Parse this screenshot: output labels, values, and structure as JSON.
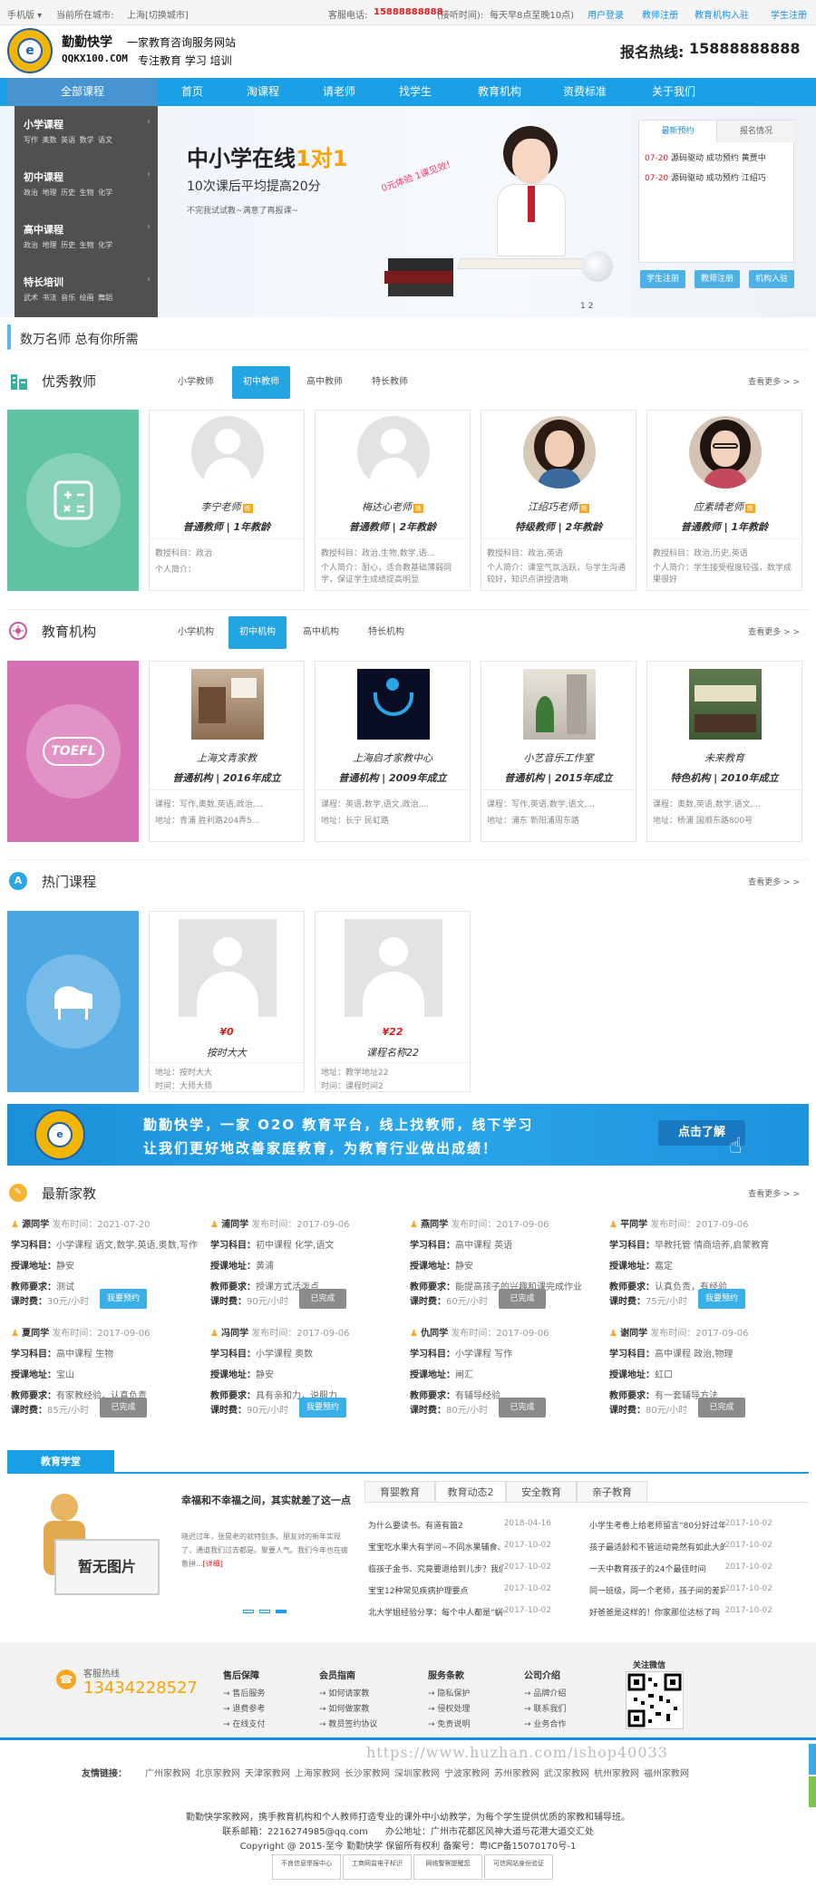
{
  "topbar": {
    "mobile": "手机版",
    "city_label": "当前所在城市:",
    "city": "上海",
    "switch_city": "[切换城市]",
    "phone_label": "客服电话:",
    "phone": "15888888888",
    "hours_label": "(接听时间):",
    "hours": "每天早8点至晚10点)",
    "login": "用户登录",
    "teacher_reg": "教师注册",
    "org_reg": "教育机构入驻",
    "student_reg": "学生注册"
  },
  "header": {
    "brand": "勤勤快学",
    "tagline": "一家教育咨询服务网站",
    "domain": "QQKX100.COM",
    "slogan": "专注教育 学习 培训",
    "hotline_label": "报名热线:",
    "hotline": "15888888888"
  },
  "nav": {
    "all": "全部课程",
    "items": [
      "首页",
      "淘课程",
      "请老师",
      "找学生",
      "教育机构",
      "资费标准",
      "关于我们"
    ]
  },
  "categories": [
    {
      "title": "小学课程",
      "subs": "写作 奥数 英语 数学 语文"
    },
    {
      "title": "初中课程",
      "subs": "政治 地理 历史 生物 化学"
    },
    {
      "title": "高中课程",
      "subs": "政治 地理 历史 生物 化学"
    },
    {
      "title": "特长培训",
      "subs": "武术 书法 音乐 绘画 舞蹈"
    }
  ],
  "banner": {
    "headline_a": "中小学在线",
    "headline_b": "1对1",
    "sub": "10次课后平均提高20分",
    "small": "不完我试试教~满意了再报课~",
    "stamp": "0元体验 1课见效！",
    "page_dots": "1  2"
  },
  "booking_panel": {
    "tab_latest": "最新预约",
    "tab_report": "报名情况",
    "rows": [
      {
        "date": "07-20",
        "text": "源码驱动 成功预约 黄贾中"
      },
      {
        "date": "07-20",
        "text": "源码驱动 成功预约 江绍巧"
      }
    ],
    "btn_student": "学生注册",
    "btn_teacher": "教师注册",
    "btn_org": "机构入驻"
  },
  "section_banner": "数万名师 总有你所需",
  "teachers": {
    "title": "优秀教师",
    "tabs": [
      "小学教师",
      "初中教师",
      "高中教师",
      "特长教师"
    ],
    "active_tab": 1,
    "more": "查看更多 > >",
    "badge": "练",
    "items": [
      {
        "name": "李宁老师",
        "level": "普通教师 | 1年教龄",
        "subject": "教授科目：政治",
        "intro": "个人简介："
      },
      {
        "name": "梅达心老师",
        "level": "普通教师 | 2年教龄",
        "subject": "教授科目：政治,生物,数学,语...",
        "intro": "个人简介：耐心，适合教基础薄弱同学，保证学生成绩提高明显"
      },
      {
        "name": "江绍巧老师",
        "level": "特级教师 | 2年教龄",
        "subject": "教授科目：政治,英语",
        "intro": "个人简介：课堂气氛活跃，与学生沟通较好，知识点讲授清晰"
      },
      {
        "name": "应素晴老师",
        "level": "普通教师 | 1年教龄",
        "subject": "教授科目：政治,历史,英语",
        "intro": "个人简介：学生接受程度较强，数学成果很好"
      }
    ]
  },
  "orgs": {
    "title": "教育机构",
    "tabs": [
      "小学机构",
      "初中机构",
      "高中机构",
      "特长机构"
    ],
    "active_tab": 1,
    "more": "查看更多 > >",
    "tile_text": "TOEFL",
    "items": [
      {
        "name": "上海文青家教",
        "level": "普通机构 | 2016年成立",
        "course": "课程：写作,奥数,英语,政治,...",
        "addr": "地址：青浦 胜利路204弄5..."
      },
      {
        "name": "上海启才家教中心",
        "level": "普通机构 | 2009年成立",
        "course": "课程：英语,数学,语文,政治,...",
        "addr": "地址：长宁 民虹路"
      },
      {
        "name": "小艺音乐工作室",
        "level": "普通机构 | 2015年成立",
        "course": "课程：写作,英语,数学,语文,...",
        "addr": "地址：浦东 新阳浦周东路"
      },
      {
        "name": "未来教育",
        "level": "特色机构 | 2010年成立",
        "course": "课程：奥数,英语,数学,语文,...",
        "addr": "地址：杨浦 国顺东路800号"
      }
    ]
  },
  "courses": {
    "title": "热门课程",
    "more": "查看更多 > >",
    "items": [
      {
        "price": "¥0",
        "name": "按时大大",
        "addr": "地址：按时大大",
        "time": "时间：大师大师"
      },
      {
        "price": "¥22",
        "name": "课程名称22",
        "addr": "地址：教学地址22",
        "time": "时间：课程时间2"
      }
    ]
  },
  "ad": {
    "line1": "勤勤快学，一家 O2O 教育平台，线上找教师，线下学习",
    "line2": "让我们更好地改善家庭教育，为教育行业做出成绩！",
    "button": "点击了解"
  },
  "jobs": {
    "title": "最新家教",
    "more": "查看更多 > >",
    "labels": {
      "posted": "发布时间：",
      "subject": "学习科目：",
      "area": "授课地址：",
      "require": "教师要求：",
      "fee": "课时费："
    },
    "items": [
      {
        "name": "源同学",
        "date": "2021-07-20",
        "subject": "小学课程 语文,数学,英语,奥数,写作",
        "area": "静安",
        "require": "测试",
        "fee": "30元/小时",
        "btn": "我要预约",
        "state": "blue"
      },
      {
        "name": "浦同学",
        "date": "2017-09-06",
        "subject": "初中课程 化学,语文",
        "area": "黄浦",
        "require": "授课方式活泼点",
        "fee": "90元/小时",
        "btn": "已完成",
        "state": "gray"
      },
      {
        "name": "燕同学",
        "date": "2017-09-06",
        "subject": "高中课程 英语",
        "area": "静安",
        "require": "能提高孩子的兴趣和课完成作业",
        "fee": "60元/小时",
        "btn": "已完成",
        "state": "gray"
      },
      {
        "name": "平同学",
        "date": "2017-09-06",
        "subject": "早教托管 情商培养,启蒙教育",
        "area": "嘉定",
        "require": "认真负责，有经验",
        "fee": "75元/小时",
        "btn": "我要预约",
        "state": "blue"
      },
      {
        "name": "夏同学",
        "date": "2017-09-06",
        "subject": "高中课程 生物",
        "area": "宝山",
        "require": "有家教经验，认真负责",
        "fee": "85元/小时",
        "btn": "已完成",
        "state": "gray"
      },
      {
        "name": "冯同学",
        "date": "2017-09-06",
        "subject": "小学课程 奥数",
        "area": "静安",
        "require": "具有亲和力，说服力",
        "fee": "90元/小时",
        "btn": "我要预约",
        "state": "blue"
      },
      {
        "name": "仇同学",
        "date": "2017-09-06",
        "subject": "小学课程 写作",
        "area": "闸汇",
        "require": "有辅导经验",
        "fee": "80元/小时",
        "btn": "已完成",
        "state": "gray"
      },
      {
        "name": "谢同学",
        "date": "2017-09-06",
        "subject": "高中课程 政治,物理",
        "area": "虹口",
        "require": "有一套辅导方法",
        "fee": "80元/小时",
        "btn": "已完成",
        "state": "gray"
      }
    ]
  },
  "edu": {
    "title": "教育学堂",
    "no_image": "暂无图片",
    "article_title": "幸福和不幸福之间，其实就差了这一点",
    "article_body": "晓迟过年，张晃老的就特别多。朋友对的新年实现了，通道我们过去都是。聚要人气。我们今年也在疲惫拼...",
    "detail": "[详细]",
    "tabs": [
      "育婴教育",
      "教育动态2",
      "安全教育",
      "亲子教育"
    ],
    "active_tab": 1,
    "news_left": [
      {
        "t": "为什么要读书。有道有篇2",
        "d": "2018-04-16"
      },
      {
        "t": "宝宝吃水果大有学问~不同水果辅食、有不",
        "d": "2017-10-02"
      },
      {
        "t": "临孩子金书、究竟要退给到儿步？我们都错",
        "d": "2017-10-02"
      },
      {
        "t": "宝宝12种常见疾病护理要点",
        "d": "2017-10-02"
      },
      {
        "t": "北大学姐经验分享：每个中人都是“蜗牛”",
        "d": "2017-10-02"
      }
    ],
    "news_right": [
      {
        "t": "小学生考卷上给老师留言“80分好过年”",
        "d": "2017-10-02"
      },
      {
        "t": "孩子最适龄和不管运动竟然有如此大的区别",
        "d": "2017-10-02"
      },
      {
        "t": "一天中教育孩子的24个最佳时间",
        "d": "2017-10-02"
      },
      {
        "t": "同一班级，同一个老师，孩子间的差异从哪",
        "d": "2017-10-02"
      },
      {
        "t": "好爸爸是这样的！你家那位达标了吗",
        "d": "2017-10-02"
      }
    ]
  },
  "footer": {
    "hotline_label": "客服热线",
    "hotline": "13434228527",
    "cols": [
      {
        "title": "售后保障",
        "items": [
          "→ 售后服务",
          "→ 退费参考",
          "→ 在线支付"
        ]
      },
      {
        "title": "会员指南",
        "items": [
          "→ 如何请家教",
          "→ 如何做家教",
          "→ 教员签约协议"
        ]
      },
      {
        "title": "服务条款",
        "items": [
          "→ 隐私保护",
          "→ 侵权处理",
          "→ 免责说明"
        ]
      },
      {
        "title": "公司介绍",
        "items": [
          "→ 品牌介绍",
          "→ 联系我们",
          "→ 业务合作"
        ]
      }
    ],
    "wechat": "关注微信",
    "watermark": "https://www.huzhan.com/ishop40033",
    "links_label": "友情链接：",
    "links": [
      "广州家教网",
      "北京家教网",
      "天津家教网",
      "上海家教网",
      "长沙家教网",
      "深圳家教网",
      "宁波家教网",
      "苏州家教网",
      "武汉家教网",
      "杭州家教网",
      "福州家教网"
    ],
    "line1": "勤勤快学家教网，携手教育机构和个人教师打造专业的课外中小幼教学，为每个学生提供优质的家教和辅导班。",
    "line2a": "联系邮箱：2216274985@qq.com",
    "line2b": "办公地址：广州市花都区风神大道与花港大道交汇处",
    "line3": "Copyright @ 2015-至今 勤勤快学 保留所有权利 备案号：粤ICP备15070170号-1",
    "certs": [
      "不良信息举报中心",
      "工商网监电子标识",
      "网络警察提醒您",
      "可信网站身份验证"
    ]
  }
}
